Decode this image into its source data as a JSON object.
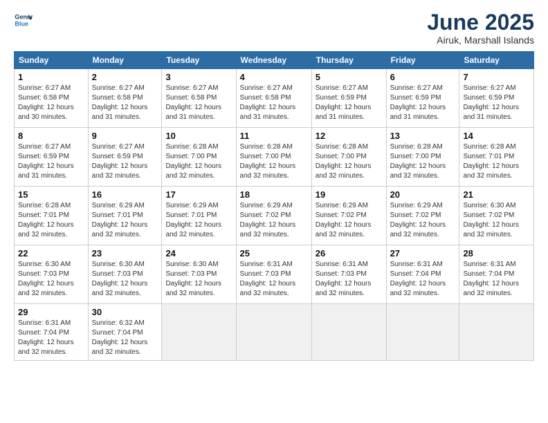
{
  "header": {
    "logo_line1": "General",
    "logo_line2": "Blue",
    "month": "June 2025",
    "location": "Airuk, Marshall Islands"
  },
  "weekdays": [
    "Sunday",
    "Monday",
    "Tuesday",
    "Wednesday",
    "Thursday",
    "Friday",
    "Saturday"
  ],
  "weeks": [
    [
      {
        "day": "1",
        "info": "Sunrise: 6:27 AM\nSunset: 6:58 PM\nDaylight: 12 hours\nand 30 minutes."
      },
      {
        "day": "2",
        "info": "Sunrise: 6:27 AM\nSunset: 6:58 PM\nDaylight: 12 hours\nand 31 minutes."
      },
      {
        "day": "3",
        "info": "Sunrise: 6:27 AM\nSunset: 6:58 PM\nDaylight: 12 hours\nand 31 minutes."
      },
      {
        "day": "4",
        "info": "Sunrise: 6:27 AM\nSunset: 6:58 PM\nDaylight: 12 hours\nand 31 minutes."
      },
      {
        "day": "5",
        "info": "Sunrise: 6:27 AM\nSunset: 6:59 PM\nDaylight: 12 hours\nand 31 minutes."
      },
      {
        "day": "6",
        "info": "Sunrise: 6:27 AM\nSunset: 6:59 PM\nDaylight: 12 hours\nand 31 minutes."
      },
      {
        "day": "7",
        "info": "Sunrise: 6:27 AM\nSunset: 6:59 PM\nDaylight: 12 hours\nand 31 minutes."
      }
    ],
    [
      {
        "day": "8",
        "info": "Sunrise: 6:27 AM\nSunset: 6:59 PM\nDaylight: 12 hours\nand 31 minutes."
      },
      {
        "day": "9",
        "info": "Sunrise: 6:27 AM\nSunset: 6:59 PM\nDaylight: 12 hours\nand 32 minutes."
      },
      {
        "day": "10",
        "info": "Sunrise: 6:28 AM\nSunset: 7:00 PM\nDaylight: 12 hours\nand 32 minutes."
      },
      {
        "day": "11",
        "info": "Sunrise: 6:28 AM\nSunset: 7:00 PM\nDaylight: 12 hours\nand 32 minutes."
      },
      {
        "day": "12",
        "info": "Sunrise: 6:28 AM\nSunset: 7:00 PM\nDaylight: 12 hours\nand 32 minutes."
      },
      {
        "day": "13",
        "info": "Sunrise: 6:28 AM\nSunset: 7:00 PM\nDaylight: 12 hours\nand 32 minutes."
      },
      {
        "day": "14",
        "info": "Sunrise: 6:28 AM\nSunset: 7:01 PM\nDaylight: 12 hours\nand 32 minutes."
      }
    ],
    [
      {
        "day": "15",
        "info": "Sunrise: 6:28 AM\nSunset: 7:01 PM\nDaylight: 12 hours\nand 32 minutes."
      },
      {
        "day": "16",
        "info": "Sunrise: 6:29 AM\nSunset: 7:01 PM\nDaylight: 12 hours\nand 32 minutes."
      },
      {
        "day": "17",
        "info": "Sunrise: 6:29 AM\nSunset: 7:01 PM\nDaylight: 12 hours\nand 32 minutes."
      },
      {
        "day": "18",
        "info": "Sunrise: 6:29 AM\nSunset: 7:02 PM\nDaylight: 12 hours\nand 32 minutes."
      },
      {
        "day": "19",
        "info": "Sunrise: 6:29 AM\nSunset: 7:02 PM\nDaylight: 12 hours\nand 32 minutes."
      },
      {
        "day": "20",
        "info": "Sunrise: 6:29 AM\nSunset: 7:02 PM\nDaylight: 12 hours\nand 32 minutes."
      },
      {
        "day": "21",
        "info": "Sunrise: 6:30 AM\nSunset: 7:02 PM\nDaylight: 12 hours\nand 32 minutes."
      }
    ],
    [
      {
        "day": "22",
        "info": "Sunrise: 6:30 AM\nSunset: 7:03 PM\nDaylight: 12 hours\nand 32 minutes."
      },
      {
        "day": "23",
        "info": "Sunrise: 6:30 AM\nSunset: 7:03 PM\nDaylight: 12 hours\nand 32 minutes."
      },
      {
        "day": "24",
        "info": "Sunrise: 6:30 AM\nSunset: 7:03 PM\nDaylight: 12 hours\nand 32 minutes."
      },
      {
        "day": "25",
        "info": "Sunrise: 6:31 AM\nSunset: 7:03 PM\nDaylight: 12 hours\nand 32 minutes."
      },
      {
        "day": "26",
        "info": "Sunrise: 6:31 AM\nSunset: 7:03 PM\nDaylight: 12 hours\nand 32 minutes."
      },
      {
        "day": "27",
        "info": "Sunrise: 6:31 AM\nSunset: 7:04 PM\nDaylight: 12 hours\nand 32 minutes."
      },
      {
        "day": "28",
        "info": "Sunrise: 6:31 AM\nSunset: 7:04 PM\nDaylight: 12 hours\nand 32 minutes."
      }
    ],
    [
      {
        "day": "29",
        "info": "Sunrise: 6:31 AM\nSunset: 7:04 PM\nDaylight: 12 hours\nand 32 minutes."
      },
      {
        "day": "30",
        "info": "Sunrise: 6:32 AM\nSunset: 7:04 PM\nDaylight: 12 hours\nand 32 minutes."
      },
      {
        "day": "",
        "info": ""
      },
      {
        "day": "",
        "info": ""
      },
      {
        "day": "",
        "info": ""
      },
      {
        "day": "",
        "info": ""
      },
      {
        "day": "",
        "info": ""
      }
    ]
  ]
}
